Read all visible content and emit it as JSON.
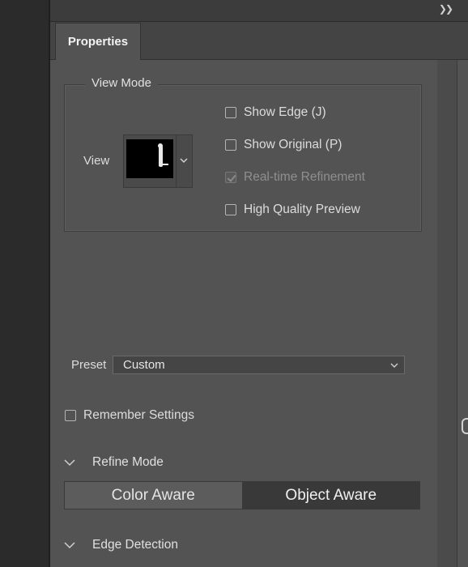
{
  "panel": {
    "tab_label": "Properties",
    "collapse_icon": "double-chevron-right-icon"
  },
  "view_mode": {
    "legend": "View Mode",
    "view_label": "View",
    "options": [
      {
        "label": "Show Edge (J)",
        "checked": false,
        "enabled": true
      },
      {
        "label": "Show Original (P)",
        "checked": false,
        "enabled": true
      },
      {
        "label": "Real-time Refinement",
        "checked": true,
        "enabled": false
      },
      {
        "label": "High Quality Preview",
        "checked": false,
        "enabled": true
      }
    ]
  },
  "preset": {
    "label": "Preset",
    "value": "Custom"
  },
  "remember": {
    "label": "Remember Settings",
    "checked": false
  },
  "refine_mode": {
    "header": "Refine Mode",
    "options": [
      "Color Aware",
      "Object Aware"
    ],
    "selected": "Object Aware"
  },
  "edge_detection": {
    "header": "Edge Detection"
  },
  "colors": {
    "panel_bg": "#535353",
    "dark_strip": "#2b2b2b",
    "selected_segment": "#393939"
  }
}
